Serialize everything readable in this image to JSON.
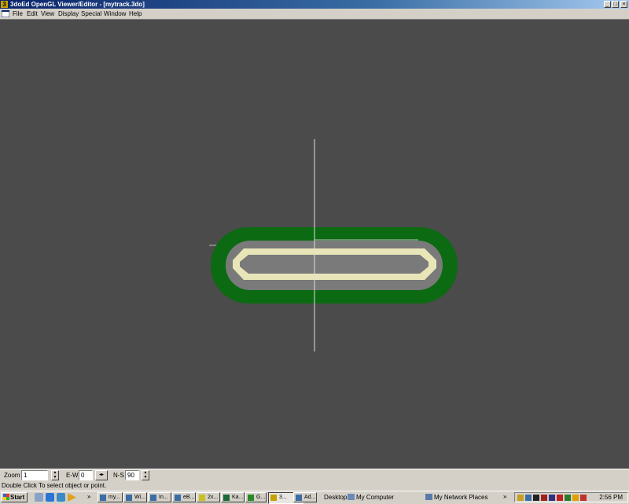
{
  "window": {
    "icon_label": "3",
    "title": "3doEd OpenGL Viewer/Editor - [mytrack.3do]",
    "caption_buttons": [
      "_",
      "□",
      "×"
    ]
  },
  "menu": [
    "File",
    "Edit",
    "View",
    "Display",
    "Special",
    "Window",
    "Help"
  ],
  "scene": {
    "background": "#4b4b4b",
    "track_green": "#0b6a12",
    "track_gray": "#7a7a7a",
    "track_cream": "#e8e6b8",
    "axis_color": "#e0e0e0"
  },
  "toolbar": {
    "zoom_label": "Zoom",
    "zoom_value": "1",
    "ew_label": "E-W",
    "ew_value": "0",
    "ns_label": "N-S",
    "ns_value": "90"
  },
  "status": "Double Click To select object or point.",
  "taskbar": {
    "start": "Start",
    "tasks": [
      "my...",
      "Wi...",
      "In...",
      "eB...",
      "2x...",
      "Ka...",
      "G...",
      "3...",
      "Ad..."
    ],
    "active_task_index": 7,
    "desktop_tools": [
      "Desktop",
      "My Computer",
      "My Network Places"
    ],
    "clock": "2:56 PM"
  }
}
